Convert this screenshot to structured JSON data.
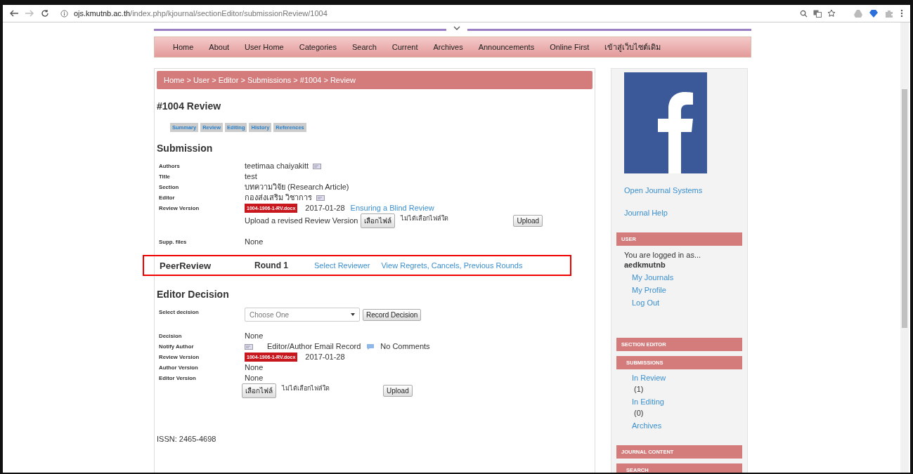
{
  "browser": {
    "url_host": "ojs.kmutnb.ac.th",
    "url_path": "/index.php/kjournal/sectionEditor/submissionReview/1004"
  },
  "nav": [
    "Home",
    "About",
    "User Home",
    "Categories",
    "Search",
    "Current",
    "Archives",
    "Announcements",
    "Online First",
    "เข้าสู่เว็บไซต์เดิม"
  ],
  "breadcrumb": "Home > User > Editor > Submissions > #1004 > Review",
  "page_title": "#1004 Review",
  "tabs": [
    "Summary",
    "Review",
    "Editing",
    "History",
    "References"
  ],
  "submission": {
    "heading": "Submission",
    "rows": [
      {
        "label": "Authors",
        "kind": "text_email",
        "value": "teetimaa chaiyakitt"
      },
      {
        "label": "Title",
        "kind": "text",
        "value": "test"
      },
      {
        "label": "Section",
        "kind": "text",
        "value": "บทความวิจัย (Research Article)"
      },
      {
        "label": "Editor",
        "kind": "text_email",
        "value": "กองส่งเสริม วิชาการ"
      },
      {
        "label": "Review Version",
        "kind": "file",
        "file": "1004-1906-1-RV.docx",
        "date": "2017-01-28",
        "link": "Ensuring a Blind Review"
      },
      {
        "label": "",
        "kind": "upload",
        "text": "Upload a revised Review Version",
        "choose": "เลือกไฟล์",
        "no_file": "ไม่ได้เลือกไฟล์ใด",
        "button": "Upload"
      },
      {
        "label": "Supp. files",
        "kind": "text",
        "value": "None"
      }
    ]
  },
  "peer_review": {
    "title": "PeerReview",
    "round": "Round 1",
    "links": [
      "Select Reviewer",
      "View Regrets, Cancels, Previous Rounds"
    ],
    "highlighted": true
  },
  "editor_decision": {
    "heading": "Editor Decision",
    "select_label": "Select decision",
    "select_value": "Choose One",
    "record_button": "Record Decision",
    "rows": [
      {
        "label": "Decision",
        "kind": "text",
        "value": "None"
      },
      {
        "label": "Notify Author",
        "kind": "notify",
        "value": "Editor/Author Email Record",
        "comments": "No Comments"
      },
      {
        "label": "Review Version",
        "kind": "file",
        "file": "1004-1906-1-RV.docx",
        "date": "2017-01-28"
      },
      {
        "label": "Author Version",
        "kind": "text",
        "value": "None"
      },
      {
        "label": "Editor Version",
        "kind": "text",
        "value": "None"
      },
      {
        "label": "",
        "kind": "upload",
        "choose": "เลือกไฟล์",
        "no_file": "ไม่ได้เลือกไฟล์ใด",
        "button": "Upload"
      }
    ]
  },
  "issn": "ISSN: 2465-4698",
  "sidebar": {
    "links": [
      "Open Journal Systems",
      "Journal Help"
    ],
    "user": {
      "heading": "USER",
      "logged_in": "You are logged in as...",
      "username": "aedkmutnb",
      "links": [
        "My Journals",
        "My Profile",
        "Log Out"
      ]
    },
    "section_editor": "SECTION EDITOR",
    "submissions": {
      "heading": "SUBMISSIONS",
      "items": [
        {
          "label": "In Review",
          "count": "(1)"
        },
        {
          "label": "In Editing",
          "count": "(0)"
        },
        {
          "label": "Archives"
        }
      ]
    },
    "journal_content": "JOURNAL CONTENT",
    "search": "SEARCH"
  }
}
